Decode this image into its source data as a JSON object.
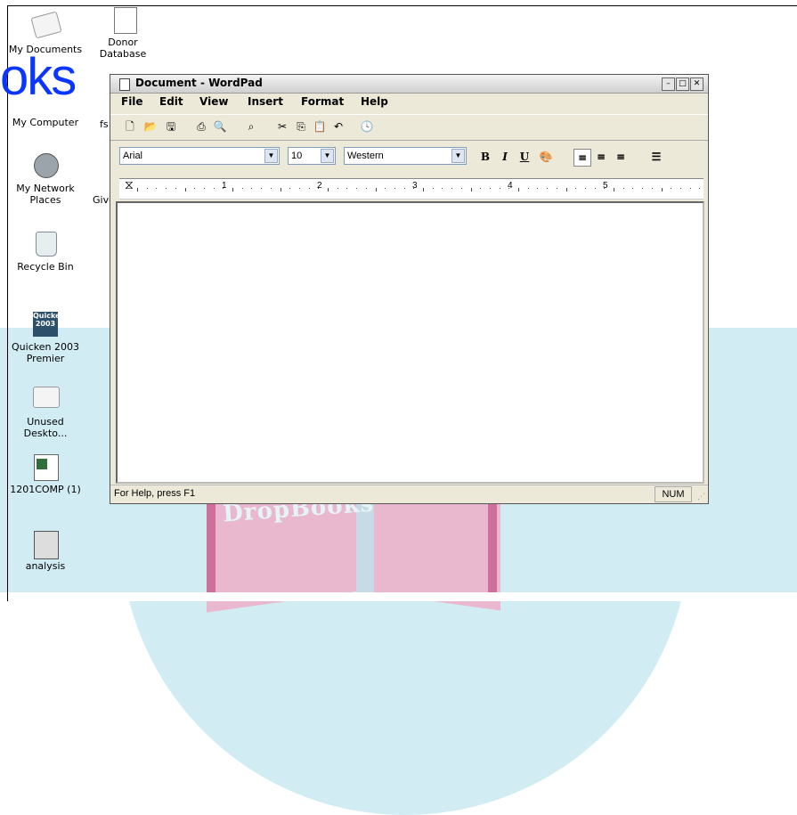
{
  "brand": {
    "text": "oks"
  },
  "watermark": {
    "text": "DropBooks"
  },
  "desktop": {
    "icons": [
      {
        "label": "My Documents",
        "icon": "my-documents-icon"
      },
      {
        "label": "Donor\nDatabase",
        "icon": "database-document-icon"
      },
      {
        "label": "My Computer",
        "icon": "my-computer-icon"
      },
      {
        "label": "fs",
        "icon": "file-icon"
      },
      {
        "label": "My Network\nPlaces",
        "icon": "network-places-icon"
      },
      {
        "label": "Give",
        "icon": "file-icon"
      },
      {
        "label": "Recycle Bin",
        "icon": "recycle-bin-icon"
      },
      {
        "label": "Quicken 2003\nPremier",
        "icon": "quicken-shortcut-icon"
      },
      {
        "label": "Unused\nDeskto...",
        "icon": "folder-icon"
      },
      {
        "label": "1201COMP (1)",
        "icon": "excel-file-icon"
      },
      {
        "label": "analysis",
        "icon": "analysis-icon"
      }
    ]
  },
  "window": {
    "title": "Document - WordPad",
    "menu": [
      "File",
      "Edit",
      "View",
      "Insert",
      "Format",
      "Help"
    ],
    "toolbar_icons": [
      "new-icon",
      "open-icon",
      "save-icon",
      "print-icon",
      "print-preview-icon",
      "find-icon",
      "cut-icon",
      "copy-icon",
      "paste-icon",
      "undo-icon",
      "date-time-icon"
    ],
    "font": "Arial",
    "size": "10",
    "script": "Western",
    "format_buttons": {
      "bold": "B",
      "italic": "I",
      "underline": "U"
    },
    "ruler_numbers": [
      "1",
      "2",
      "3",
      "4",
      "5"
    ],
    "status": "For Help, press F1",
    "num": "NUM"
  },
  "colors": {
    "brand": "#0a36ff",
    "watermark_blue": "#d2ecf4",
    "watermark_pink": "#e9b8cf"
  }
}
